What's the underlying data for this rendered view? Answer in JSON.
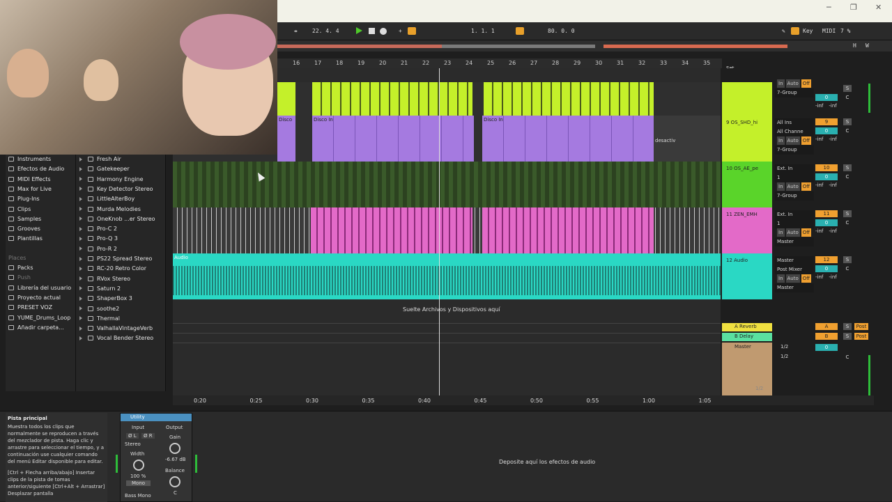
{
  "window": {
    "controls": [
      "─",
      "❐",
      "✕"
    ]
  },
  "transport": {
    "position": "22.  4.  4",
    "loop_start": "1.   1.   1",
    "loop_length": "80.   0.   0",
    "key_label": "Key",
    "midi_label": "MIDI",
    "cpu": "7 %",
    "h": "H",
    "w": "W"
  },
  "ruler": {
    "bars": [
      "16",
      "17",
      "18",
      "19",
      "20",
      "21",
      "22",
      "23",
      "24",
      "25",
      "26",
      "27",
      "28",
      "29",
      "30",
      "31",
      "32",
      "33",
      "34",
      "35"
    ],
    "set_label": "Set"
  },
  "browser": {
    "categories": [
      "Instruments",
      "Efectos de Audio",
      "MIDI Effects",
      "Max for Live",
      "Plug-Ins",
      "Clips",
      "Samples",
      "Grooves",
      "Plantillas"
    ],
    "places_label": "Places",
    "places": [
      "Packs",
      "Push",
      "Librería del usuario",
      "Proyecto actual",
      "PRESET VOZ",
      "YUME_Drums_Loop",
      "Añadir carpeta..."
    ],
    "plugins": [
      "Fresh Air",
      "Gatekeeper",
      "Harmony Engine",
      "Key Detector Stereo",
      "LittleAlterBoy",
      "Murda Melodies",
      "OneKnob ...er Stereo",
      "Pro-C 2",
      "Pro-Q 3",
      "Pro-R 2",
      "PS22 Spread Stereo",
      "RC-20 Retro Color",
      "RVox Stereo",
      "Saturn 2",
      "ShaperBox 3",
      "soothe2",
      "Thermal",
      "ValhallaVintageVerb",
      "Vocal Bender Stereo"
    ]
  },
  "clips": {
    "disco": "Disco In",
    "disco_short": "Disco",
    "desactiv": "desactiv",
    "audio": "Audio"
  },
  "drop_zone": "Suelte Archivos y Dispositivos aquí",
  "tracks": [
    {
      "name": "",
      "color": "#c4f02a",
      "input": "",
      "chan": "",
      "monitor": [
        "In",
        "Auto",
        "Off"
      ],
      "out": "7-Group",
      "num": "",
      "vol": "0",
      "pan": "C",
      "inf1": "-inf",
      "inf2": "-inf"
    },
    {
      "name": "9 OS_SHD_hi",
      "color": "#c4f02a",
      "input": "All Ins",
      "chan": "All Channe",
      "monitor": [
        "In",
        "Auto",
        "Off"
      ],
      "out": "7-Group",
      "num": "9",
      "vol": "0",
      "pan": "C",
      "inf1": "-inf",
      "inf2": "-inf"
    },
    {
      "name": "10 OS_AE_pe",
      "color": "#5ad42a",
      "input": "Ext. In",
      "chan": "1",
      "monitor": [
        "In",
        "Auto",
        "Off"
      ],
      "out": "7-Group",
      "num": "10",
      "vol": "0",
      "pan": "C",
      "inf1": "-inf",
      "inf2": "-inf"
    },
    {
      "name": "11 ZEN_EMH",
      "color": "#e36ac8",
      "input": "Ext. In",
      "chan": "1",
      "monitor": [
        "In",
        "Auto",
        "Off"
      ],
      "out": "Master",
      "num": "11",
      "vol": "0",
      "pan": "C",
      "inf1": "-inf",
      "inf2": "-inf"
    },
    {
      "name": "12 Audio",
      "color": "#2ad8c4",
      "input": "Master",
      "chan": "Post Mixer",
      "monitor": [
        "In",
        "Auto",
        "Off"
      ],
      "out": "Master",
      "num": "12",
      "vol": "0",
      "pan": "C",
      "inf1": "-inf",
      "inf2": "-inf"
    }
  ],
  "returns": [
    {
      "name": "A Reverb",
      "color": "#f0e040",
      "letter": "A",
      "s": "S",
      "post": "Post"
    },
    {
      "name": "B Delay",
      "color": "#5ae0a0",
      "letter": "B",
      "s": "S",
      "post": "Post"
    }
  ],
  "master": {
    "name": "Master",
    "color": "#c09a70",
    "io1": "1/2",
    "io2": "1/2",
    "vol": "0",
    "pan": "C",
    "page": "1/2"
  },
  "timebar": [
    "0:20",
    "0:25",
    "0:30",
    "0:35",
    "0:40",
    "0:45",
    "0:50",
    "0:55",
    "1:00",
    "1:05"
  ],
  "info": {
    "title": "Pista principal",
    "body": "Muestra todos los clips que normalmente se reproducen a través del mezclador de pista. Haga clic y arrastre para seleccionar el tiempo, y a continuación use cualquier comando del menú Editar disponible para editar.",
    "shortcuts": "[Ctrl + Flecha arriba/abajo] Insertar clips de la pista de tomas anterior/siguiente [Ctrl+Alt + Arrastrar] Desplazar pantalla"
  },
  "device": {
    "name": "Utility",
    "input": "Input",
    "output": "Output",
    "phase_l": "Ø L",
    "phase_r": "Ø R",
    "mode": "Stereo",
    "width_label": "Width",
    "width_val": "100 %",
    "mono": "Mono",
    "gain_label": "Gain",
    "gain_val": "-6.67 dB",
    "balance_label": "Balance",
    "balance_val": "C",
    "bass_mono": "Bass Mono"
  },
  "fx_drop": "Deposite aquí los efectos de audio"
}
